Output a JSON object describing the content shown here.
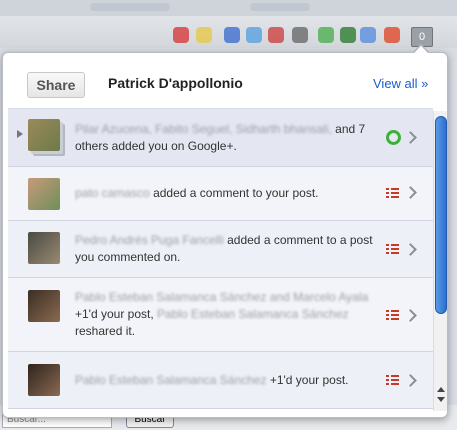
{
  "header": {
    "share_label": "Share",
    "user_name": "Patrick D'appollonio",
    "view_all_label": "View all »"
  },
  "toolbar": {
    "notification_count": "0"
  },
  "footer": {
    "search_placeholder": "Buscar...",
    "search_button_label": "Buscar"
  },
  "notifications": [
    {
      "actors": "Pilar Azucena, Fabito Seguel, Sidharth bhansali,",
      "text": "and 7 others added you on Google+.",
      "icon": "circle-add-icon"
    },
    {
      "actors": "pato camasco",
      "text": "added a comment to your post.",
      "icon": "post-list-icon"
    },
    {
      "actors": "Pedro Andrés Puga Fancelli",
      "text": "added a comment to a post you commented on.",
      "icon": "post-list-icon"
    },
    {
      "actors": "Pablo Esteban Salamanca Sánchez and Marcelo Ayala",
      "text": "+1'd your post,",
      "actors2": "Pablo Esteban Salamanca Sánchez",
      "text2": "reshared it.",
      "icon": "post-list-icon"
    },
    {
      "actors": "Pablo Esteban Salamanca Sánchez",
      "text": "+1'd your post.",
      "icon": "post-list-icon"
    }
  ],
  "colors": {
    "link_blue": "#1a5fcc",
    "circle_green": "#3db039",
    "post_icon_red": "#c43c28",
    "scroll_blue": "#2b6fd0"
  }
}
